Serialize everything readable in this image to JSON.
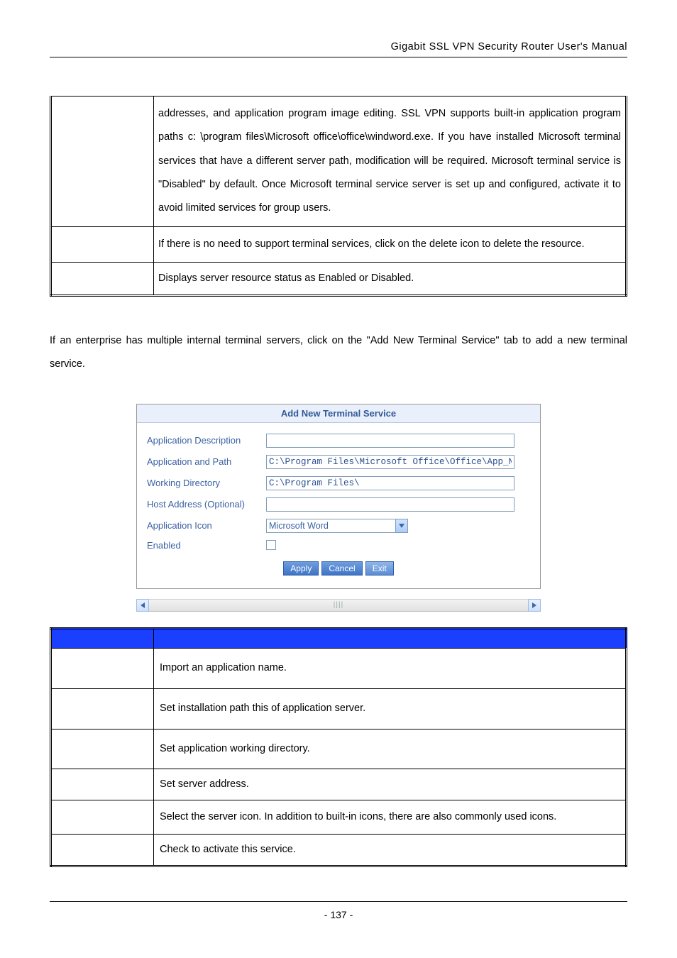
{
  "header": {
    "title": "Gigabit  SSL  VPN  Security  Router  User's  Manual"
  },
  "table1": {
    "r1": "addresses, and application program image editing. SSL VPN supports built-in application program paths c: \\program files\\Microsoft office\\office\\windword.exe. If you have installed Microsoft terminal services that have a different server path, modification will be required. Microsoft terminal service is \"Disabled\" by default. Once Microsoft terminal service server is set up and configured, activate it to avoid limited services for group users.",
    "r2": "If there is no need to support terminal services, click on the delete icon to delete the resource.",
    "r3": "Displays server resource status as Enabled or Disabled."
  },
  "para": "If an enterprise has multiple internal terminal servers, click on the \"Add New Terminal Service\" tab to add a new terminal service.",
  "panel": {
    "title": "Add New Terminal Service",
    "labels": {
      "appDesc": "Application Description",
      "appPath": "Application and Path",
      "workDir": "Working Directory",
      "hostAddr": "Host Address (Optional)",
      "appIcon": "Application Icon",
      "enabled": "Enabled"
    },
    "values": {
      "appDesc": "",
      "appPath": "C:\\Program Files\\Microsoft Office\\Office\\App_Name",
      "workDir": "C:\\Program Files\\",
      "hostAddr": "",
      "appIcon": "Microsoft Word"
    },
    "buttons": {
      "apply": "Apply",
      "cancel": "Cancel",
      "exit": "Exit"
    }
  },
  "table2": {
    "r1": "Import an application name.",
    "r2": "Set installation path this of application server.",
    "r3": "Set application working directory.",
    "r4": "Set server address.",
    "r5": "Select the server icon. In addition to built-in icons, there are also commonly used icons.",
    "r6": "Check to activate this service."
  },
  "footer": {
    "page": "- 137 -"
  }
}
